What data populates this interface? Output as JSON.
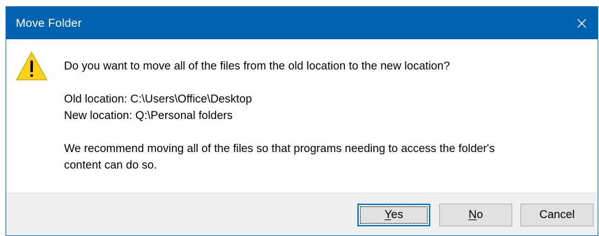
{
  "window": {
    "title": "Move Folder",
    "close_icon": "close-icon",
    "titlebar_color": "#0063b1"
  },
  "message": {
    "icon": "warning-icon",
    "question": "Do you want to move all of the files from the old location to the new location?",
    "old_location": "Old location: C:\\Users\\Office\\Desktop",
    "new_location": "New location: Q:\\Personal folders",
    "recommendation_line1": "We recommend moving all of the files so that programs needing to access the folder's",
    "recommendation_line2": "content can do so."
  },
  "buttons": {
    "yes": {
      "accel": "Y",
      "rest": "es"
    },
    "no": {
      "accel": "N",
      "rest": "o"
    },
    "cancel": {
      "label": "Cancel"
    }
  }
}
